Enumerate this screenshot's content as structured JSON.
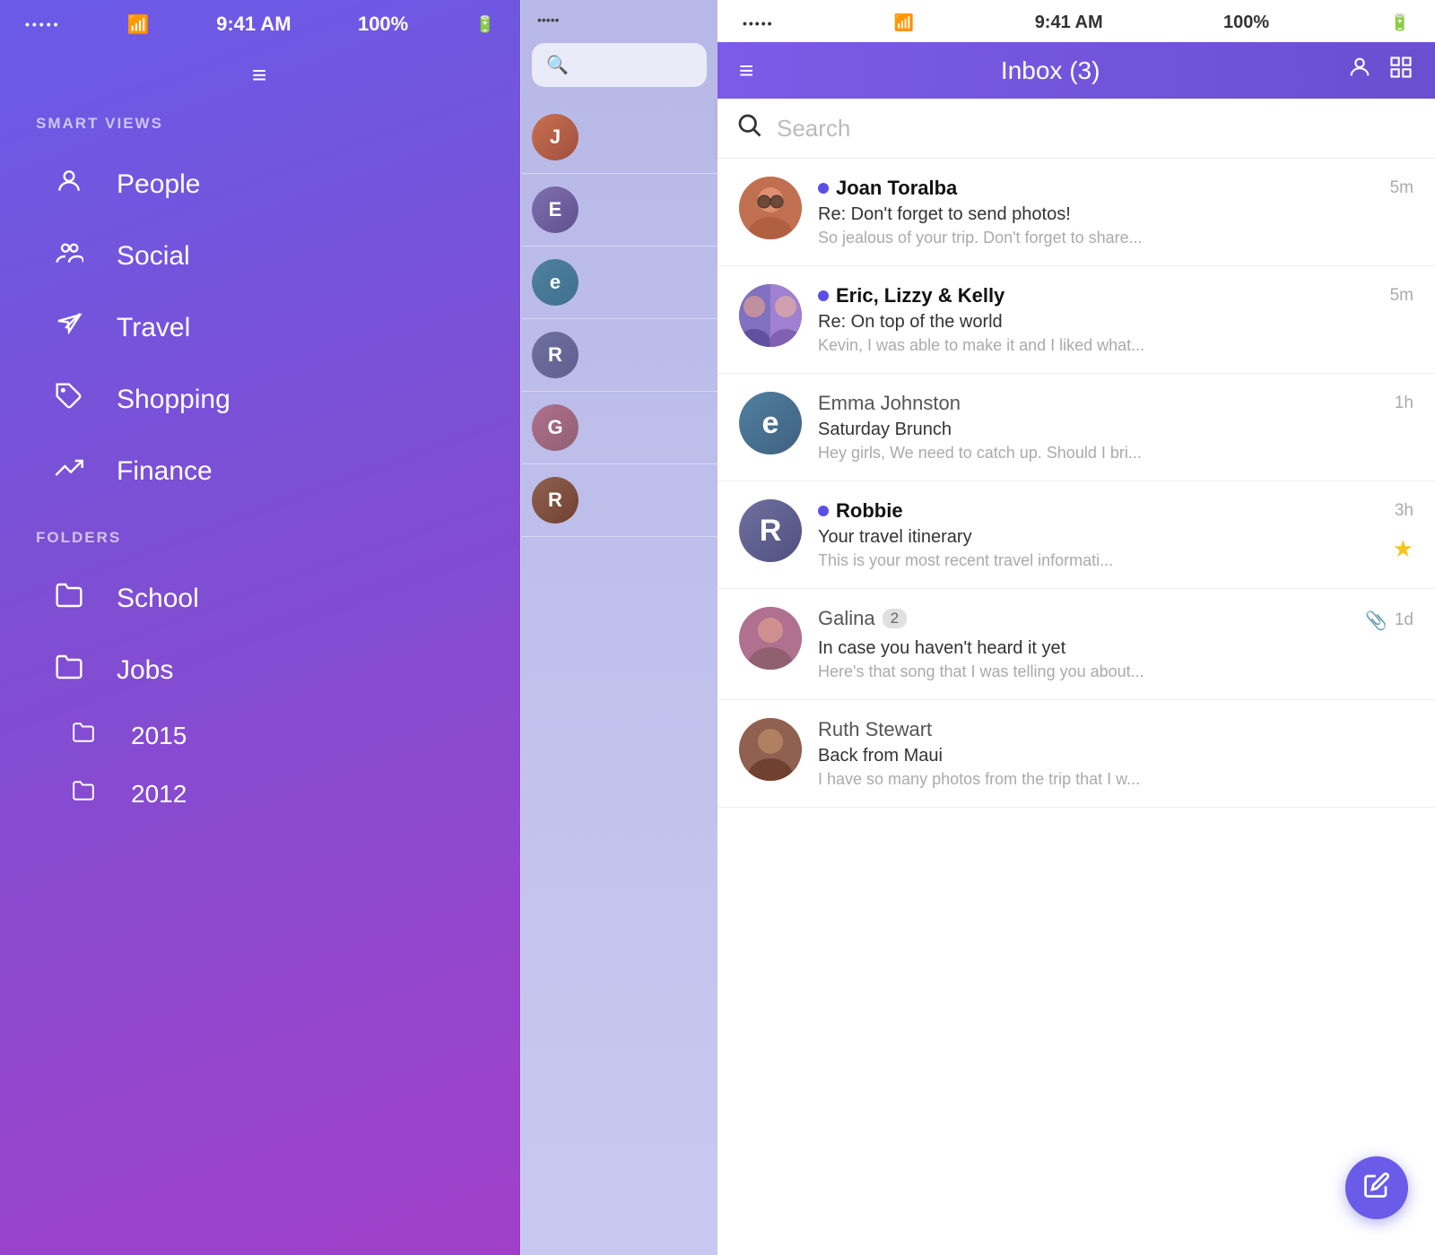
{
  "leftPhone": {
    "statusBar": {
      "dots": "•••••",
      "wifi": "WiFi",
      "time": "9:41 AM",
      "battery": "100%"
    },
    "menuIcon": "≡",
    "smartViews": {
      "sectionLabel": "SMART VIEWS",
      "items": [
        {
          "id": "people",
          "icon": "person",
          "label": "People"
        },
        {
          "id": "social",
          "icon": "social",
          "label": "Social"
        },
        {
          "id": "travel",
          "icon": "travel",
          "label": "Travel"
        },
        {
          "id": "shopping",
          "icon": "shopping",
          "label": "Shopping"
        },
        {
          "id": "finance",
          "icon": "finance",
          "label": "Finance"
        }
      ]
    },
    "folders": {
      "sectionLabel": "FOLDERS",
      "items": [
        {
          "id": "school",
          "label": "School"
        },
        {
          "id": "jobs",
          "label": "Jobs"
        },
        {
          "id": "2015",
          "label": "2015",
          "indented": true
        },
        {
          "id": "2012",
          "label": "2012",
          "indented": true
        }
      ]
    }
  },
  "rightPhone": {
    "statusBar": {
      "dots": "•••••",
      "wifi": "WiFi",
      "time": "9:41 AM",
      "battery": "100%"
    },
    "header": {
      "menuIcon": "≡",
      "title": "Inbox (3)",
      "profileIcon": "👤",
      "layoutIcon": "⊞"
    },
    "search": {
      "placeholder": "Search"
    },
    "emails": [
      {
        "id": "joan",
        "sender": "Joan Toralba",
        "time": "5m",
        "subject": "Re: Don't forget to send photos!",
        "preview": "So jealous of your trip. Don't forget to share...",
        "unread": true,
        "avatarColor": "#c97050",
        "avatarType": "photo",
        "starred": false,
        "hasAttachment": false,
        "badge": null
      },
      {
        "id": "eric",
        "sender": "Eric, Lizzy & Kelly",
        "time": "5m",
        "subject": "Re: On top of the world",
        "preview": "Kevin, I was able to make it and I liked what...",
        "unread": true,
        "avatarColor": "#7060c0",
        "avatarType": "photo",
        "starred": false,
        "hasAttachment": false,
        "badge": null
      },
      {
        "id": "emma",
        "sender": "Emma Johnston",
        "time": "1h",
        "subject": "Saturday Brunch",
        "preview": "Hey girls, We need to catch up. Should I bri...",
        "unread": false,
        "avatarColor": "#5080a0",
        "avatarLetter": "e",
        "avatarType": "letter",
        "starred": false,
        "hasAttachment": false,
        "badge": null
      },
      {
        "id": "robbie",
        "sender": "Robbie",
        "time": "3h",
        "subject": "Your travel itinerary",
        "preview": "This is your most recent travel informati...",
        "unread": true,
        "avatarColor": "#7070a0",
        "avatarLetter": "R",
        "avatarType": "letter",
        "starred": true,
        "hasAttachment": false,
        "badge": null
      },
      {
        "id": "galina",
        "sender": "Galina",
        "time": "1d",
        "subject": "In case you haven't heard it yet",
        "preview": "Here's that song that I was telling you about...",
        "unread": false,
        "avatarColor": "#a06080",
        "avatarType": "photo",
        "starred": false,
        "hasAttachment": true,
        "badge": "2"
      },
      {
        "id": "ruth",
        "sender": "Ruth Stewart",
        "time": "",
        "subject": "Back from Maui",
        "preview": "I have so many photos from the trip that I w...",
        "unread": false,
        "avatarColor": "#806050",
        "avatarType": "photo",
        "starred": false,
        "hasAttachment": false,
        "badge": null
      }
    ],
    "composeBtnLabel": "✏️"
  }
}
